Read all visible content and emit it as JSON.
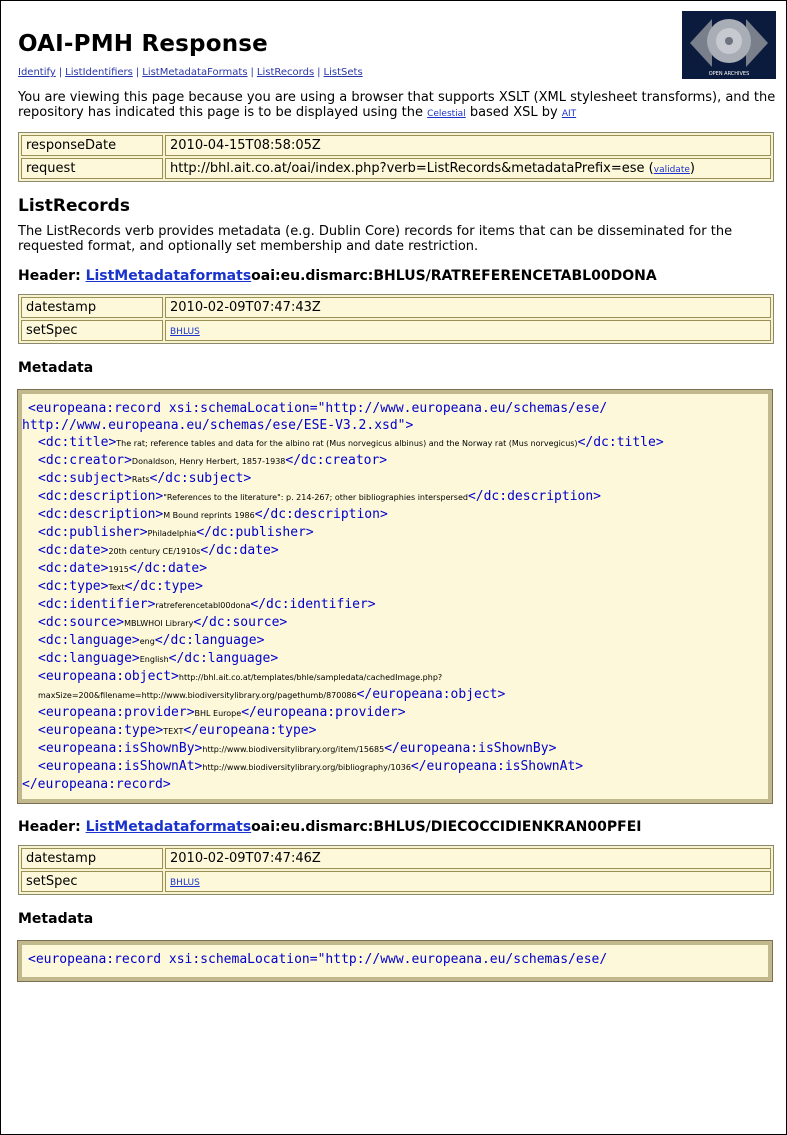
{
  "page": {
    "title": "OAI-PMH Response",
    "nav": [
      "Identify",
      "ListIdentifiers",
      "ListMetadataFormats",
      "ListRecords",
      "ListSets"
    ],
    "intro_text": "You are viewing this page because you are using a browser that supports XSLT (XML stylesheet transforms), and the repository has indicated this page is to be displayed using the ",
    "intro_link1": "Celestial",
    "intro_mid": " based XSL by ",
    "intro_link2": "AIT",
    "logo_text": "OPEN ARCHIVES"
  },
  "response": {
    "responseDate_label": "responseDate",
    "responseDate": "2010-04-15T08:58:05Z",
    "request_label": "request",
    "request": "http://bhl.ait.co.at/oai/index.php?verb=ListRecords&metadataPrefix=ese",
    "validate": "validate"
  },
  "listrecords": {
    "heading": "ListRecords",
    "description": "The ListRecords verb provides metadata (e.g. Dublin Core) records for items that can be disseminated for the requested format, and optionally set membership and date restriction."
  },
  "records": [
    {
      "header_prefix": "Header: ",
      "header_link": "ListMetadataformats",
      "identifier": "oai:eu.dismarc:BHLUS/RATREFERENCETABL00DONA",
      "datestamp_label": "datestamp",
      "datestamp": "2010-02-09T07:47:43Z",
      "setspec_label": "setSpec",
      "setspec": "BHLUS",
      "metadata_heading": "Metadata"
    },
    {
      "header_prefix": "Header: ",
      "header_link": "ListMetadataformats",
      "identifier": "oai:eu.dismarc:BHLUS/DIECOCCIDIENKRAN00PFEI",
      "datestamp_label": "datestamp",
      "datestamp": "2010-02-09T07:47:46Z",
      "setspec_label": "setSpec",
      "setspec": "BHLUS",
      "metadata_heading": "Metadata"
    }
  ],
  "xml": {
    "root_open": "<europeana:record xsi:schemaLocation=\"http://www.europeana.eu/schemas/ese/",
    "root_open2": "http://www.europeana.eu/schemas/ese/ESE-V3.2.xsd\">",
    "title_v": "The rat; reference tables and data for the albino rat (Mus norvegicus albinus) and the Norway rat (Mus norvegicus)",
    "creator_v": "Donaldson, Henry Herbert, 1857-1938",
    "subject_v": "Rats",
    "description1_v": "\"References to the literature\": p. 214-267; other bibliographies interspersed",
    "description2_v": "M Bound reprints 1986",
    "publisher_v": "Philadelphia",
    "date1_v": "20th century CE/1910s",
    "date2_v": "1915",
    "type_v": "Text",
    "identifier_v": "ratreferencetabl00dona",
    "source_v": "MBLWHOI Library",
    "language1_v": "eng",
    "language2_v": "English",
    "object_v": "http://bhl.ait.co.at/templates/bhle/sampledata/cachedImage.php?maxSize=200&filename=http://www.biodiversitylibrary.org/pagethumb/870086",
    "provider_v": "BHL Europe",
    "etype_v": "TEXT",
    "isShownBy_v": "http://www.biodiversitylibrary.org/item/15685",
    "isShownAt_v": "http://www.biodiversitylibrary.org/bibliography/1036",
    "root_close": "</europeana:record>",
    "second_root_open": "<europeana:record xsi:schemaLocation=\"http://www.europeana.eu/schemas/ese/"
  }
}
